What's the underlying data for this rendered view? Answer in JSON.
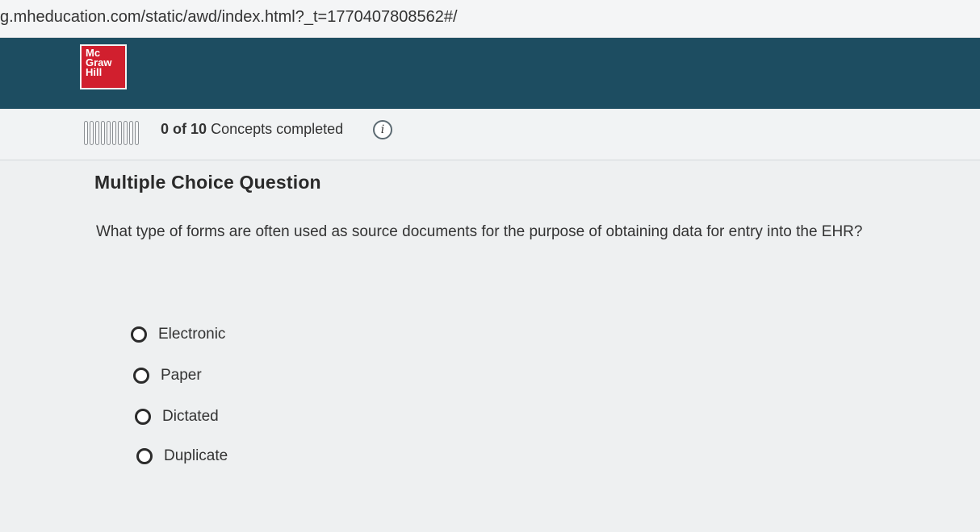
{
  "browser": {
    "url": "g.mheducation.com/static/awd/index.html?_t=1770407808562#/"
  },
  "header": {
    "logo_lines": [
      "Mc",
      "Graw",
      "Hill"
    ]
  },
  "progress": {
    "completed": "0",
    "of_label": "of",
    "total": "10",
    "suffix": "Concepts completed",
    "segments_total": 10,
    "segments_filled": 0,
    "info_icon": "info-icon"
  },
  "question": {
    "heading": "Multiple Choice Question",
    "text": "What type of forms are often used as source documents for the purpose of obtaining data for entry into the EHR?",
    "choices": [
      {
        "label": "Electronic",
        "selected": false
      },
      {
        "label": "Paper",
        "selected": false
      },
      {
        "label": "Dictated",
        "selected": false
      },
      {
        "label": "Duplicate",
        "selected": false
      }
    ]
  },
  "colors": {
    "header_bg": "#1d4d61",
    "logo_red": "#d11f2e",
    "meter_fill": "#2e5a70"
  }
}
